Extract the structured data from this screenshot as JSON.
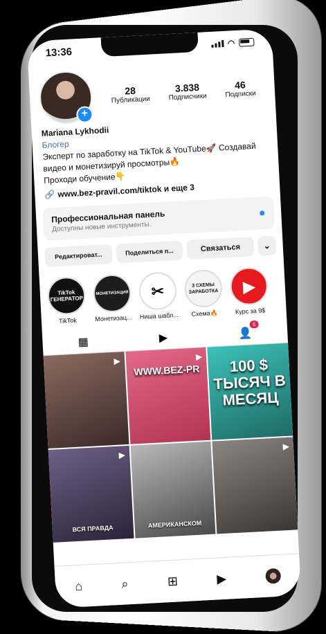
{
  "status": {
    "time": "13:36"
  },
  "profile": {
    "name": "Mariana Lykhodii",
    "category": "Блогер",
    "bio_line1": "Эксперт по заработку на TikTok & YouTube🚀 Создавай",
    "bio_line2": "видео и монетизируй просмотры🔥",
    "bio_line3": "Проходи обучение👇",
    "link": "www.bez-pravil.com/tiktok и еще 3",
    "stats": [
      {
        "value": "28",
        "label": "Публикации"
      },
      {
        "value": "3.838",
        "label": "Подписчики"
      },
      {
        "value": "46",
        "label": "Подписки"
      }
    ]
  },
  "pro_panel": {
    "title": "Профессиональная панель",
    "subtitle": "Доступны новые инструменты."
  },
  "actions": {
    "edit": "Редактироват...",
    "share": "Поделиться п...",
    "contact": "Связаться",
    "more": "⌄"
  },
  "highlights": [
    {
      "label": "TikTok",
      "circle_text": "TikTok ГЕНЕРАТОР",
      "color": "#111111"
    },
    {
      "label": "Монетизац...",
      "circle_text": "МОНЕТИЗАЦИЯ",
      "color": "#1d1d1d"
    },
    {
      "label": "Ниша шабл...",
      "circle_text": "✂",
      "color": "#ffffff"
    },
    {
      "label": "Схема🔥",
      "circle_text": "3 СХЕМЫ ЗАРАБОТКА",
      "color": "#f4f4f4"
    },
    {
      "label": "Курс за 9$",
      "circle_text": "▶",
      "color": "#e5191e"
    }
  ],
  "tabs": {
    "badge": "6"
  },
  "posts": [
    {
      "caption": "",
      "big": "",
      "color": "#5a3c3a"
    },
    {
      "caption": "",
      "big": "WWW.BEZ-PR",
      "color": "#d34a6a"
    },
    {
      "caption": "",
      "big": "100 $ ТЫСЯЧ В МЕСЯЦ",
      "color": "#2fa7a0"
    },
    {
      "caption": "ВСЯ ПРАВДА",
      "big": "",
      "color": "#3d3552"
    },
    {
      "caption": "АМЕРИКАНСКОМ",
      "big": "",
      "color": "#6a6a6a"
    },
    {
      "caption": "",
      "big": "",
      "color": "#4e4a48"
    }
  ]
}
